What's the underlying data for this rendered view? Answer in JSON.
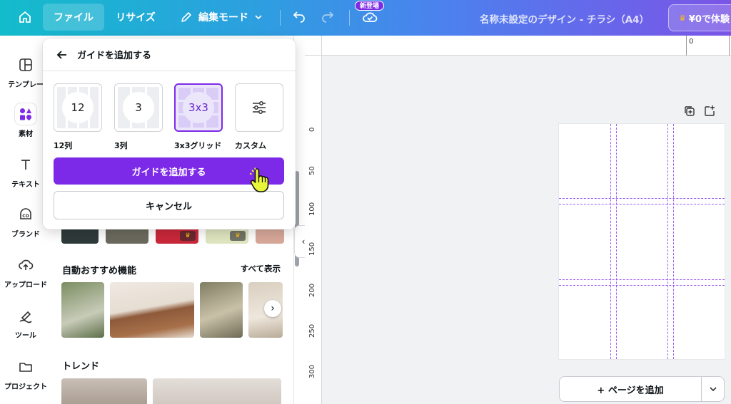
{
  "topbar": {
    "file_label": "ファイル",
    "resize_label": "リサイズ",
    "edit_mode_label": "編集モード",
    "new_badge": "新登場",
    "doc_title": "名称未設定のデザイン - チラシ（A4）",
    "trial_label": "¥0で体験"
  },
  "rail": [
    {
      "label": "テンプレー",
      "icon": "template-icon"
    },
    {
      "label": "素材",
      "icon": "elements-icon"
    },
    {
      "label": "テキスト",
      "icon": "text-icon"
    },
    {
      "label": "ブランド",
      "icon": "brand-icon"
    },
    {
      "label": "アップロード",
      "icon": "upload-icon"
    },
    {
      "label": "ツール",
      "icon": "draw-icon"
    },
    {
      "label": "プロジェクト",
      "icon": "folder-icon"
    }
  ],
  "panel": {
    "auto_section_title": "自動おすすめ機能",
    "see_all": "すべて表示",
    "trend_section_title": "トレンド"
  },
  "popup": {
    "title": "ガイドを追加する",
    "options": [
      {
        "value": "12",
        "label": "12列"
      },
      {
        "value": "3",
        "label": "3列"
      },
      {
        "value": "3x3",
        "label": "3x3グリッド"
      },
      {
        "value": "",
        "label": "カスタム"
      }
    ],
    "selected_index": 2,
    "add_button": "ガイドを追加する",
    "cancel_button": "キャンセル"
  },
  "ruler": {
    "top_ticks": [
      "0"
    ],
    "left_ticks": [
      "0",
      "50",
      "100",
      "150",
      "200",
      "250",
      "300"
    ]
  },
  "canvas": {
    "add_page_label": "+ ページを追加"
  },
  "colors": {
    "accent": "#7d2ae8",
    "guide": "#9b5bf0"
  }
}
